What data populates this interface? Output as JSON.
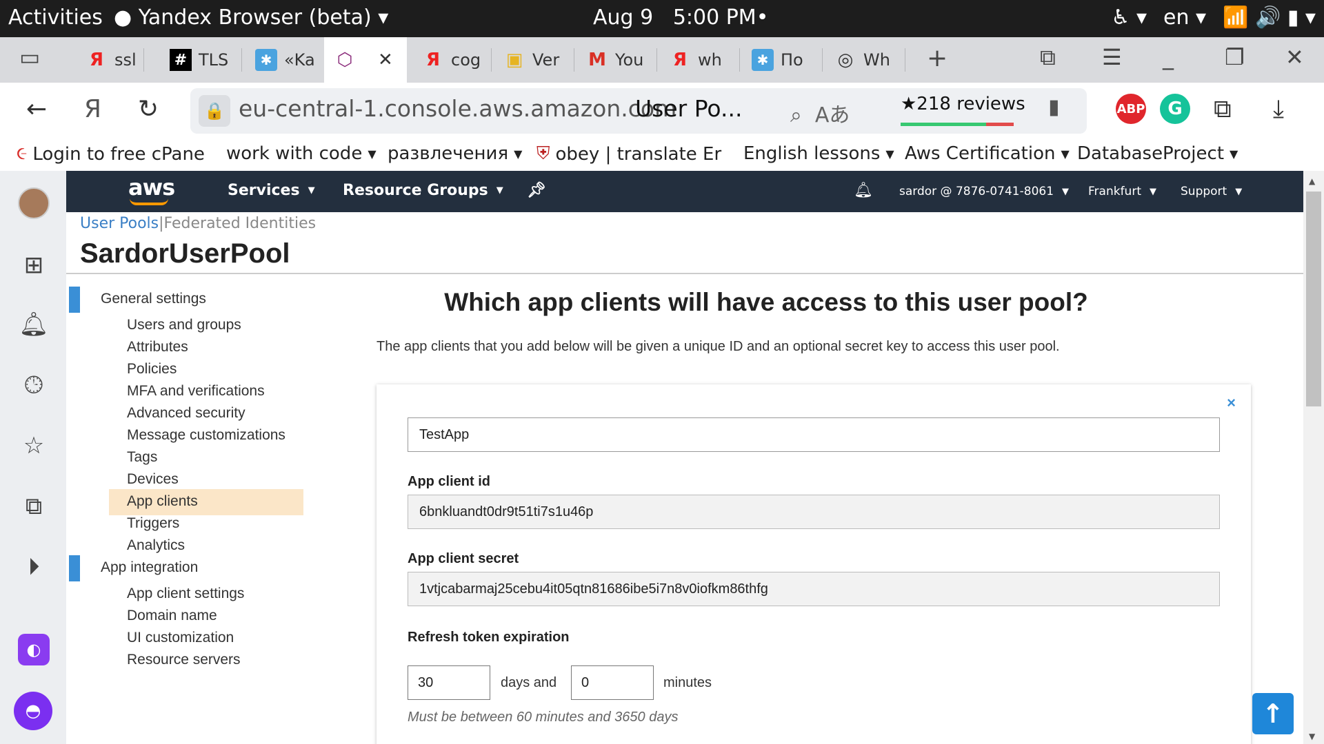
{
  "os": {
    "activities": "Activities",
    "app_name": "Yandex Browser (beta)",
    "date": "Aug 9",
    "time": "5:00 PM",
    "language": "en"
  },
  "tabs": [
    {
      "label": "ssl",
      "icon": "Я",
      "color": "#e22"
    },
    {
      "label": "TLS",
      "icon": "#",
      "color": "#000"
    },
    {
      "label": "«Ka",
      "icon": "✱",
      "color": "#4aa3df"
    },
    {
      "label": "",
      "icon": "⬡",
      "color": "#8a2a7a"
    },
    {
      "label": "cog",
      "icon": "Я",
      "color": "#e22"
    },
    {
      "label": "Ver",
      "icon": "▣",
      "color": "#e6b422"
    },
    {
      "label": "You",
      "icon": "M",
      "color": "#d93025"
    },
    {
      "label": "wh",
      "icon": "Я",
      "color": "#e22"
    },
    {
      "label": "По",
      "icon": "✱",
      "color": "#4aa3df"
    },
    {
      "label": "Wh",
      "icon": "◎",
      "color": "#333"
    }
  ],
  "address": {
    "url": "eu-central-1.console.aws.amazon.com",
    "page_title": "User Po...",
    "reviews": "★218 reviews"
  },
  "extensions": {
    "abp": "ABP",
    "grammarly": "G"
  },
  "bookmarks": [
    {
      "label": "Login to free cPane",
      "caret": false
    },
    {
      "label": "work with code",
      "caret": true
    },
    {
      "label": "развлечения",
      "caret": true
    },
    {
      "label": "obey | translate Er",
      "caret": false
    },
    {
      "label": "English lessons",
      "caret": true
    },
    {
      "label": "Aws Certification",
      "caret": true
    },
    {
      "label": "DatabaseProject",
      "caret": true
    }
  ],
  "aws_nav": {
    "logo": "aws",
    "services": "Services",
    "resource_groups": "Resource Groups",
    "account": "sardor @ 7876-0741-8061",
    "region": "Frankfurt",
    "support": "Support"
  },
  "breadcrumb": {
    "user_pools": "User Pools",
    "separator": "|",
    "federated": "Federated Identities"
  },
  "pool_name": "SardorUserPool",
  "menu": {
    "general_settings": "General settings",
    "general_items": [
      "Users and groups",
      "Attributes",
      "Policies",
      "MFA and verifications",
      "Advanced security",
      "Message customizations",
      "Tags",
      "Devices",
      "App clients",
      "Triggers",
      "Analytics"
    ],
    "active_item": "App clients",
    "app_integration": "App integration",
    "integration_items": [
      "App client settings",
      "Domain name",
      "UI customization",
      "Resource servers"
    ]
  },
  "main": {
    "heading": "Which app clients will have access to this user pool?",
    "description": "The app clients that you add below will be given a unique ID and an optional secret key to access this user pool.",
    "close": "×",
    "app_name_value": "TestApp",
    "client_id_label": "App client id",
    "client_id_value": "6bnkluandt0dr9t51ti7s1u46p",
    "client_secret_label": "App client secret",
    "client_secret_value": "1vtjcabarmaj25cebu4it05qtn81686ibe5i7n8v0iofkm86thfg",
    "refresh_label": "Refresh token expiration",
    "days_value": "30",
    "days_text": "days and",
    "minutes_value": "0",
    "minutes_text": "minutes",
    "hint": "Must be between 60 minutes and 3650 days"
  }
}
